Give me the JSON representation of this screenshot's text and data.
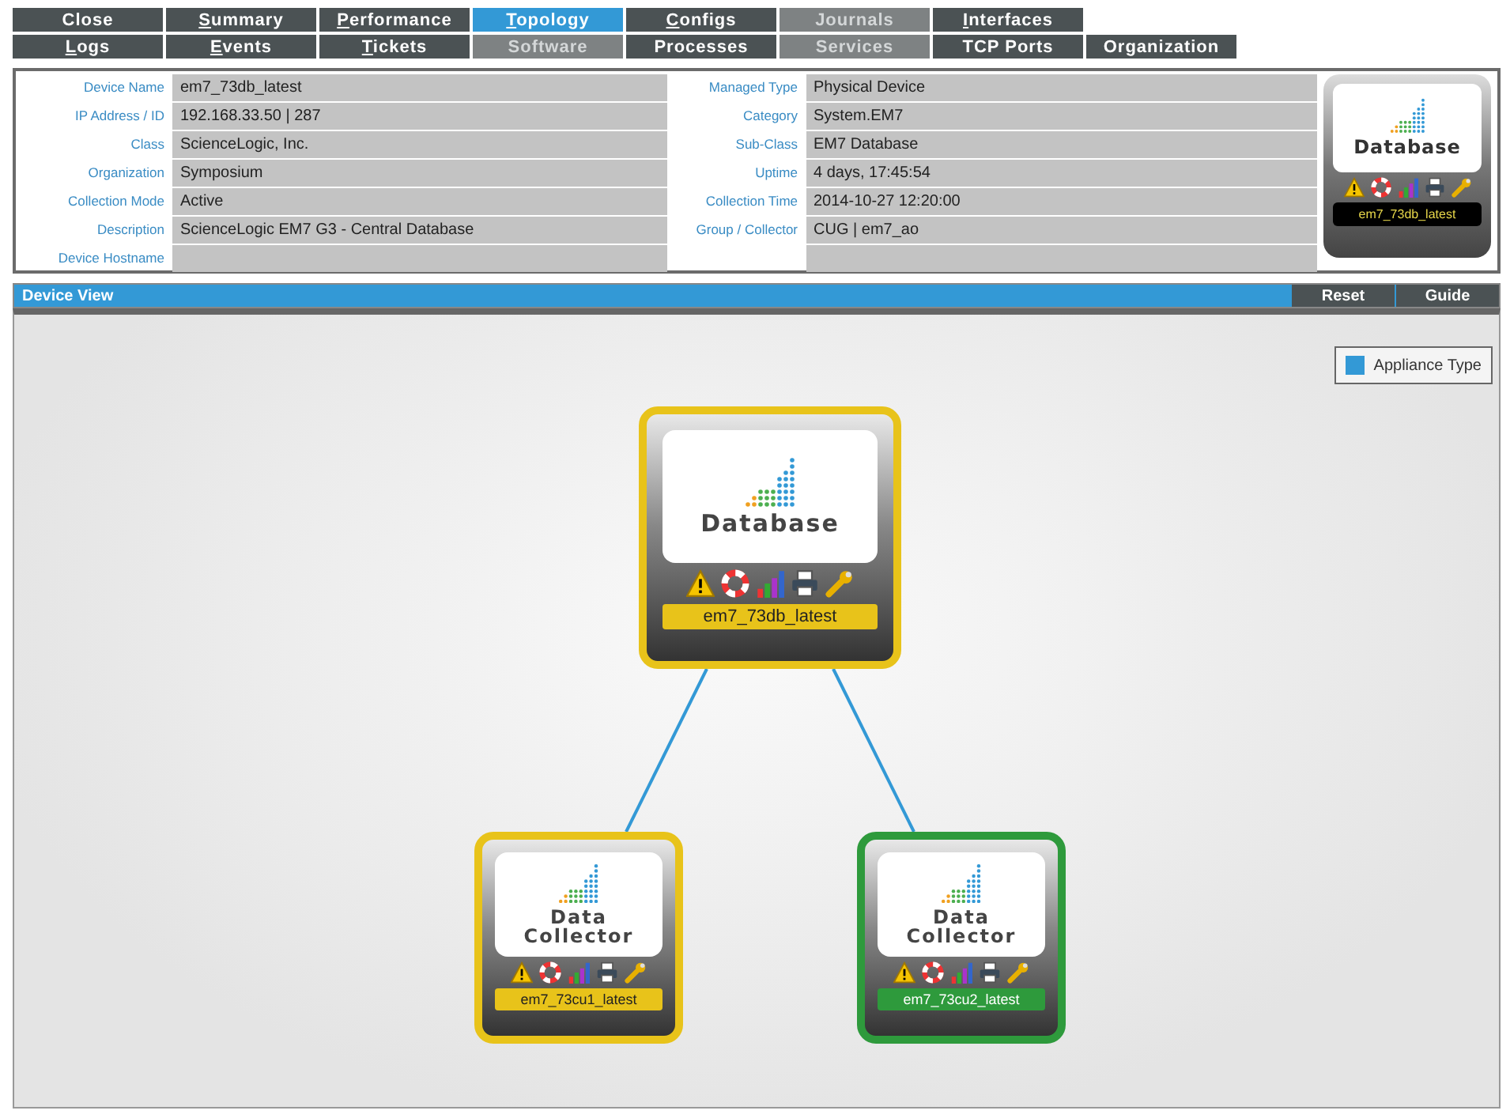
{
  "tabs_rows": [
    [
      {
        "label": "Close",
        "underline_first": false,
        "selected": false,
        "disabled": false
      },
      {
        "label": "Summary",
        "underline_first": true,
        "selected": false,
        "disabled": false
      },
      {
        "label": "Performance",
        "underline_first": true,
        "selected": false,
        "disabled": false
      },
      {
        "label": "Topology",
        "underline_first": true,
        "selected": true,
        "disabled": false
      },
      {
        "label": "Configs",
        "underline_first": true,
        "selected": false,
        "disabled": false
      },
      {
        "label": "Journals",
        "underline_first": false,
        "selected": false,
        "disabled": true
      },
      {
        "label": "Interfaces",
        "underline_first": true,
        "selected": false,
        "disabled": false
      }
    ],
    [
      {
        "label": "Logs",
        "underline_first": true,
        "selected": false,
        "disabled": false
      },
      {
        "label": "Events",
        "underline_first": true,
        "selected": false,
        "disabled": false
      },
      {
        "label": "Tickets",
        "underline_first": true,
        "selected": false,
        "disabled": false
      },
      {
        "label": "Software",
        "underline_first": false,
        "selected": false,
        "disabled": true
      },
      {
        "label": "Processes",
        "underline_first": false,
        "selected": false,
        "disabled": false
      },
      {
        "label": "Services",
        "underline_first": false,
        "selected": false,
        "disabled": true
      },
      {
        "label": "TCP Ports",
        "underline_first": false,
        "selected": false,
        "disabled": false
      },
      {
        "label": "Organization",
        "underline_first": false,
        "selected": false,
        "disabled": false
      }
    ]
  ],
  "device_info": {
    "left": [
      {
        "label": "Device Name",
        "value": "em7_73db_latest"
      },
      {
        "label": "IP Address / ID",
        "value": "192.168.33.50 | 287"
      },
      {
        "label": "Class",
        "value": "ScienceLogic, Inc."
      },
      {
        "label": "Organization",
        "value": "Symposium"
      },
      {
        "label": "Collection Mode",
        "value": "Active"
      },
      {
        "label": "Description",
        "value": "ScienceLogic EM7 G3 - Central Database"
      },
      {
        "label": "Device Hostname"
      }
    ],
    "right": [
      {
        "label": "Managed Type",
        "value": "Physical Device"
      },
      {
        "label": "Category",
        "value": "System.EM7"
      },
      {
        "label": "Sub-Class",
        "value": "EM7 Database"
      },
      {
        "label": "Uptime",
        "value": "4 days, 17:45:54"
      },
      {
        "label": "Collection Time",
        "value": "2014-10-27 12:20:00"
      },
      {
        "label": "Group / Collector",
        "value": "CUG | em7_ao"
      }
    ],
    "thumbnail": {
      "type": "Database",
      "name": "em7_73db_latest"
    }
  },
  "device_view": {
    "title": "Device View",
    "buttons": [
      "Reset",
      "Guide"
    ],
    "legend": {
      "label": "Appliance Type",
      "color": "#3399d6"
    },
    "nodes": [
      {
        "type": "Database",
        "name": "em7_73db_latest",
        "color": "#e8c31a",
        "kind": "hub"
      },
      {
        "type": "Data Collector",
        "name": "em7_73cu1_latest",
        "color": "#e8c31a",
        "kind": "leaf"
      },
      {
        "type": "Data Collector",
        "name": "em7_73cu2_latest",
        "color": "#2e9a3c",
        "kind": "leaf"
      }
    ]
  }
}
